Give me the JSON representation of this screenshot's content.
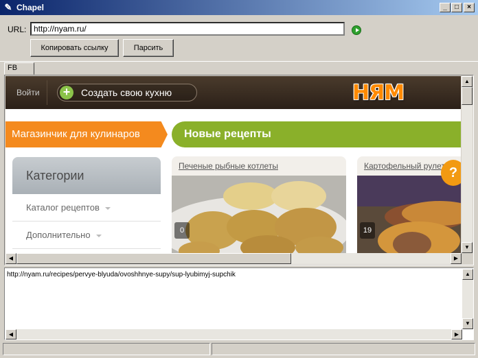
{
  "window": {
    "title": "Chapel",
    "min": "_",
    "max": "□",
    "close": "×"
  },
  "toolbar": {
    "url_label": "URL:",
    "url_value": "http://nyam.ru/",
    "copy_label": "Копировать ссылку",
    "parse_label": "Парсить"
  },
  "tabs": [
    {
      "label": "FB"
    }
  ],
  "site": {
    "login": "Войти",
    "create": "Создать свою кухню",
    "logo": "НЯМ",
    "shop_banner": "Магазинчик для кулинаров",
    "new_recipes": "Новые рецепты",
    "categories_title": "Категории",
    "categories": [
      {
        "label": "Каталог рецептов"
      },
      {
        "label": "Дополнительно"
      }
    ],
    "cards": [
      {
        "title": "Печеные рыбные котлеты",
        "count": "0"
      },
      {
        "title": "Картофельный рулет",
        "count": "19"
      }
    ],
    "help": "?"
  },
  "output": {
    "text": "http://nyam.ru/recipes/pervye-blyuda/ovoshhnye-supy/sup-lyubimyj-supchik"
  },
  "colors": {
    "orange": "#f48a1e",
    "green": "#8ab02a",
    "titlebar": "#0a246a"
  }
}
